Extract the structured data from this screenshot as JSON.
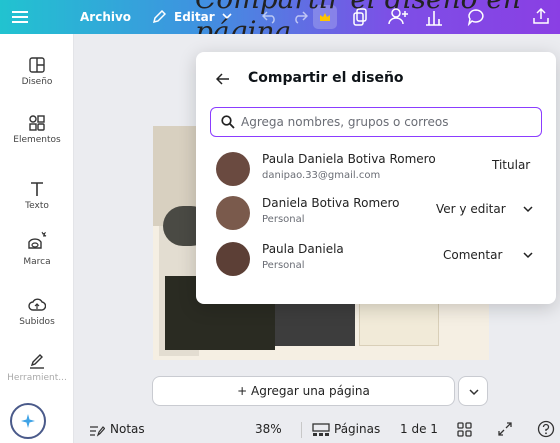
{
  "overlay_title": "Compartir el diseño en página",
  "topbar": {
    "file_label": "Archivo",
    "edit_label": "Editar"
  },
  "sidebar": {
    "items": [
      {
        "label": "Diseño",
        "icon": "layout-icon"
      },
      {
        "label": "Elementos",
        "icon": "elements-icon"
      },
      {
        "label": "Texto",
        "icon": "text-icon"
      },
      {
        "label": "Marca",
        "icon": "brand-icon"
      },
      {
        "label": "Subidos",
        "icon": "upload-icon"
      },
      {
        "label": "Herramient...",
        "icon": "draw-icon"
      }
    ]
  },
  "share_panel": {
    "title": "Compartir el diseño",
    "search_placeholder": "Agrega nombres, grupos o correos",
    "people": [
      {
        "name": "Paula Daniela Botiva Romero",
        "sub": "danipao.33@gmail.com",
        "role": "Titular",
        "dropdown": false
      },
      {
        "name": "Daniela Botiva Romero",
        "sub": "Personal",
        "role": "Ver y editar",
        "dropdown": true
      },
      {
        "name": "Paula Daniela",
        "sub": "Personal",
        "role": "Comentar",
        "dropdown": true
      }
    ]
  },
  "canvas": {
    "add_page_label": "+ Agregar una página"
  },
  "bottombar": {
    "notes_label": "Notas",
    "zoom": "38%",
    "pages_label": "Páginas",
    "page_count": "1 de 1"
  },
  "colors": {
    "accent": "#8b3dff",
    "topbar_start": "#21c3d0",
    "topbar_end": "#8a3fe4"
  }
}
